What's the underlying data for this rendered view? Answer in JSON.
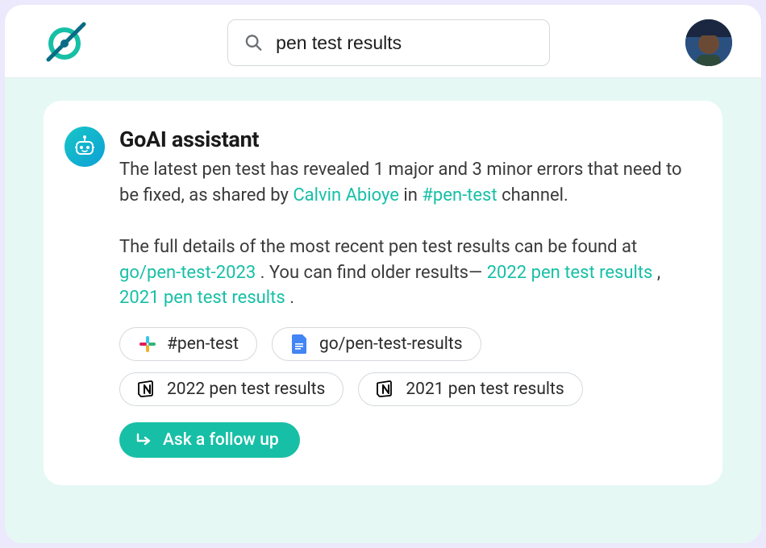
{
  "search": {
    "value": "pen test results"
  },
  "assistant": {
    "title": "GoAI assistant",
    "para1_pre": "The latest pen test has revealed 1 major and 3 minor errors that need to be fixed, as shared by ",
    "para1_person": "Calvin Abioye",
    "para1_mid": " in ",
    "para1_channel": "#pen-test",
    "para1_post": " channel.",
    "para2_pre": "The full details of the most recent pen test results can be found at ",
    "para2_link1": "go/pen-test-2023",
    "para2_mid": ". You can find older results—",
    "para2_link2": "2022 pen test results",
    "para2_sep": ", ",
    "para2_link3": "2021 pen test results",
    "para2_post": "."
  },
  "chips": {
    "slack": "#pen-test",
    "gdoc": "go/pen-test-results",
    "notion1": "2022 pen test results",
    "notion2": "2021 pen test results"
  },
  "followup": {
    "label": "Ask a follow up"
  }
}
